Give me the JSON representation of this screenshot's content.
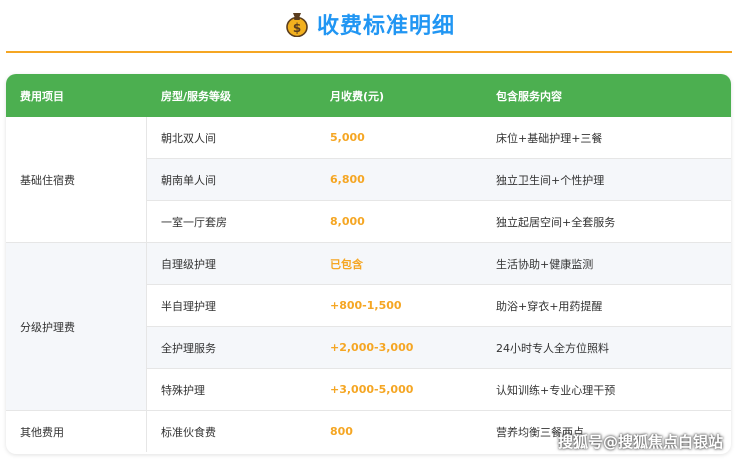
{
  "header": {
    "title": "收费标准明细",
    "icon": "money-bag-icon"
  },
  "colors": {
    "accent": "#f5a623",
    "header_green": "#4caf50",
    "title_blue": "#2196f3"
  },
  "table": {
    "columns": [
      "费用项目",
      "房型/服务等级",
      "月收费(元)",
      "包含服务内容"
    ],
    "groups": [
      {
        "label": "基础住宿费",
        "rows": [
          {
            "level": "朝北双人间",
            "price": "5,000",
            "content": "床位+基础护理+三餐"
          },
          {
            "level": "朝南单人间",
            "price": "6,800",
            "content": "独立卫生间+个性护理"
          },
          {
            "level": "一室一厅套房",
            "price": "8,000",
            "content": "独立起居空间+全套服务"
          }
        ]
      },
      {
        "label": "分级护理费",
        "rows": [
          {
            "level": "自理级护理",
            "price": "已包含",
            "content": "生活协助+健康监测"
          },
          {
            "level": "半自理护理",
            "price": "+800-1,500",
            "content": "助浴+穿衣+用药提醒"
          },
          {
            "level": "全护理服务",
            "price": "+2,000-3,000",
            "content": "24小时专人全方位照料"
          },
          {
            "level": "特殊护理",
            "price": "+3,000-5,000",
            "content": "认知训练+专业心理干预"
          }
        ]
      },
      {
        "label": "其他费用",
        "rows": [
          {
            "level": "标准伙食费",
            "price": "800",
            "content": "营养均衡三餐两点"
          }
        ]
      }
    ]
  },
  "watermark": "搜狐号@搜狐焦点白银站"
}
